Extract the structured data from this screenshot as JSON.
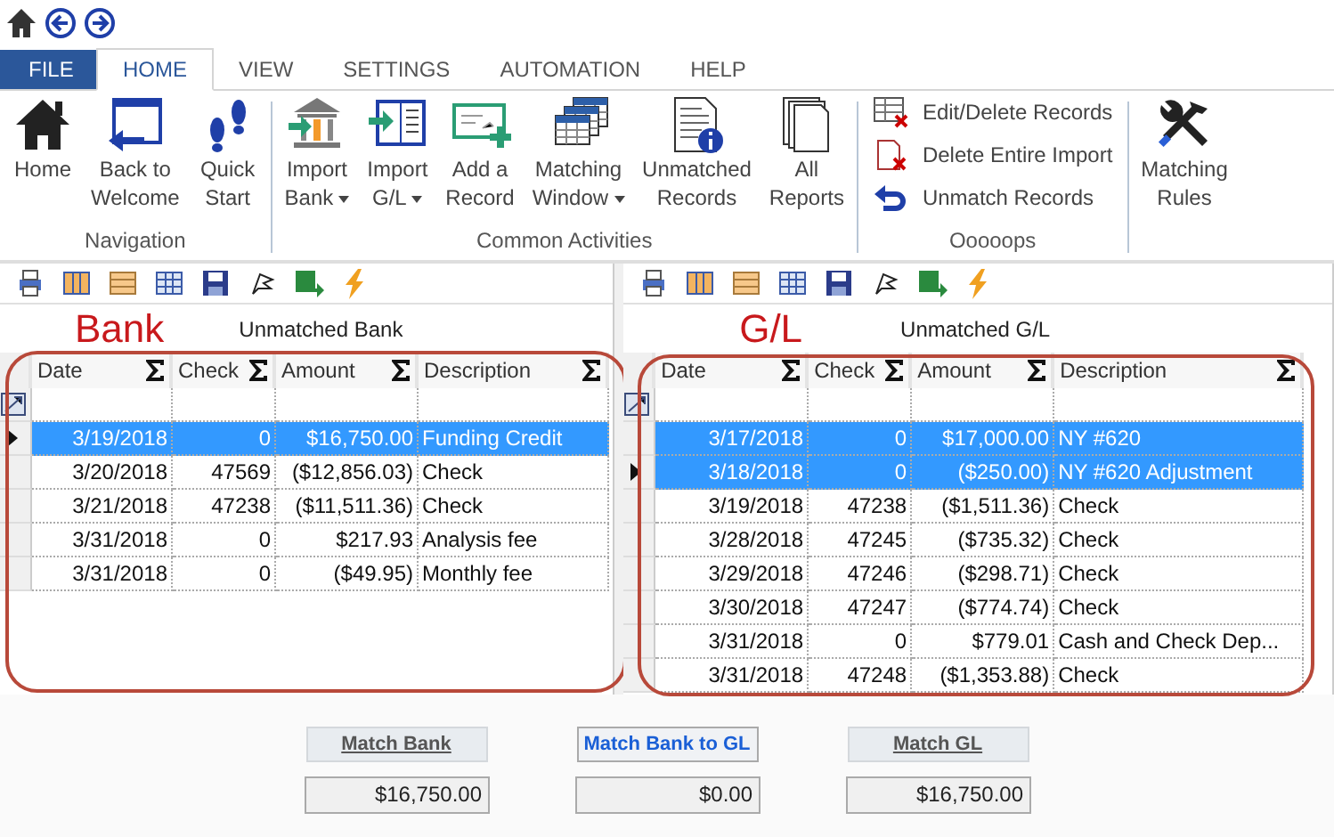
{
  "tabs": [
    {
      "label": "FILE",
      "kind": "file",
      "selected": false
    },
    {
      "label": "HOME",
      "kind": "tab",
      "selected": true
    },
    {
      "label": "VIEW",
      "kind": "tab",
      "selected": false
    },
    {
      "label": "SETTINGS",
      "kind": "tab",
      "selected": false
    },
    {
      "label": "AUTOMATION",
      "kind": "tab",
      "selected": false
    },
    {
      "label": "HELP",
      "kind": "tab",
      "selected": false
    }
  ],
  "ribbon": {
    "groups": [
      {
        "label": "Navigation",
        "buttons": [
          {
            "kind": "large",
            "lines": [
              "Home"
            ],
            "dropdown": false
          },
          {
            "kind": "large",
            "lines": [
              "Back to",
              "Welcome"
            ],
            "dropdown": false
          },
          {
            "kind": "large",
            "lines": [
              "Quick",
              "Start"
            ],
            "dropdown": false
          }
        ]
      },
      {
        "label": "Common Activities",
        "buttons": [
          {
            "kind": "large",
            "lines": [
              "Import",
              "Bank"
            ],
            "dropdown": true
          },
          {
            "kind": "large",
            "lines": [
              "Import",
              "G/L"
            ],
            "dropdown": true
          },
          {
            "kind": "large",
            "lines": [
              "Add a",
              "Record"
            ],
            "dropdown": false
          },
          {
            "kind": "large",
            "lines": [
              "Matching",
              "Window"
            ],
            "dropdown": true
          },
          {
            "kind": "large",
            "lines": [
              "Unmatched",
              "Records"
            ],
            "dropdown": false
          },
          {
            "kind": "large",
            "lines": [
              "All",
              "Reports"
            ],
            "dropdown": false
          }
        ]
      },
      {
        "label": "Ooooops",
        "buttons": [
          {
            "kind": "small",
            "lines": [
              "Edit/Delete Records"
            ]
          },
          {
            "kind": "small",
            "lines": [
              "Delete Entire Import"
            ]
          },
          {
            "kind": "small",
            "lines": [
              "Unmatch Records"
            ]
          }
        ]
      },
      {
        "buttons": [
          {
            "kind": "large",
            "lines": [
              "Matching",
              "Rules"
            ],
            "dropdown": false
          }
        ]
      }
    ]
  },
  "panes": [
    {
      "annotation": "Bank",
      "title": "Unmatched Bank",
      "columns": [
        "Date",
        "Check",
        "Amount",
        "Description"
      ],
      "rows": [
        {
          "cells": [
            "3/19/2018",
            "0",
            "$16,750.00",
            "Funding Credit"
          ],
          "selected": true,
          "current": true
        },
        {
          "cells": [
            "3/20/2018",
            "47569",
            "($12,856.03)",
            "Check"
          ],
          "selected": false,
          "current": false
        },
        {
          "cells": [
            "3/21/2018",
            "47238",
            "($11,511.36)",
            "Check"
          ],
          "selected": false,
          "current": false
        },
        {
          "cells": [
            "3/31/2018",
            "0",
            "$217.93",
            "Analysis fee"
          ],
          "selected": false,
          "current": false
        },
        {
          "cells": [
            "3/31/2018",
            "0",
            "($49.95)",
            "Monthly fee"
          ],
          "selected": false,
          "current": false
        }
      ]
    },
    {
      "annotation": "G/L",
      "title": "Unmatched G/L",
      "columns": [
        "Date",
        "Check",
        "Amount",
        "Description"
      ],
      "rows": [
        {
          "cells": [
            "3/17/2018",
            "0",
            "$17,000.00",
            "NY #620"
          ],
          "selected": true,
          "current": false
        },
        {
          "cells": [
            "3/18/2018",
            "0",
            "($250.00)",
            "NY #620 Adjustment"
          ],
          "selected": true,
          "current": true
        },
        {
          "cells": [
            "3/19/2018",
            "47238",
            "($1,511.36)",
            "Check"
          ],
          "selected": false,
          "current": false
        },
        {
          "cells": [
            "3/28/2018",
            "47245",
            "($735.32)",
            "Check"
          ],
          "selected": false,
          "current": false
        },
        {
          "cells": [
            "3/29/2018",
            "47246",
            "($298.71)",
            "Check"
          ],
          "selected": false,
          "current": false
        },
        {
          "cells": [
            "3/30/2018",
            "47247",
            "($774.74)",
            "Check"
          ],
          "selected": false,
          "current": false
        },
        {
          "cells": [
            "3/31/2018",
            "0",
            "$779.01",
            "Cash and Check Dep..."
          ],
          "selected": false,
          "current": false
        },
        {
          "cells": [
            "3/31/2018",
            "47248",
            "($1,353.88)",
            "Check"
          ],
          "selected": false,
          "current": false
        }
      ]
    }
  ],
  "totals": [
    {
      "button": "Match Bank",
      "kind": "link",
      "value": "$16,750.00"
    },
    {
      "button": "Match Bank to GL",
      "kind": "primary",
      "value": "$0.00"
    },
    {
      "button": "Match GL",
      "kind": "link",
      "value": "$16,750.00"
    }
  ]
}
